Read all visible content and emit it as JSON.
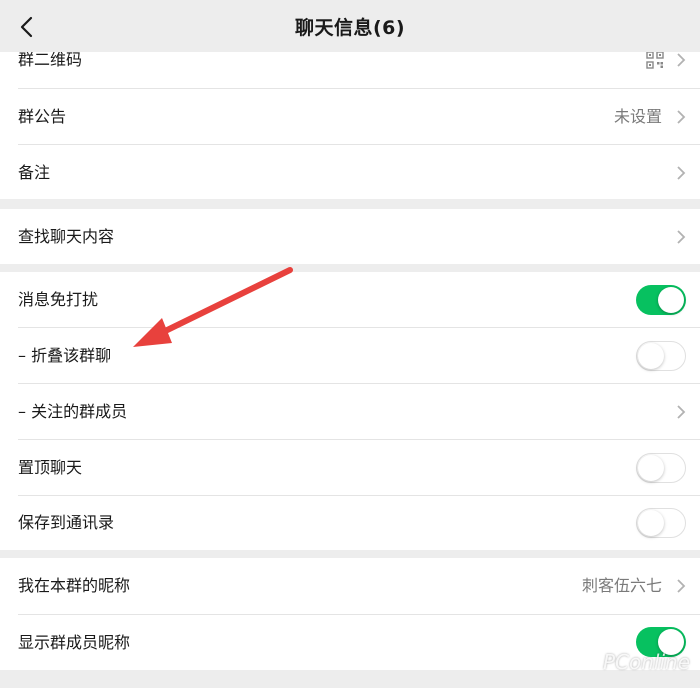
{
  "header": {
    "title": "聊天信息(6)"
  },
  "section1": {
    "rows": [
      {
        "label": "群二维码"
      },
      {
        "label": "群公告",
        "value": "未设置"
      },
      {
        "label": "备注"
      }
    ]
  },
  "section2": {
    "rows": [
      {
        "label": "查找聊天内容"
      }
    ]
  },
  "section3": {
    "rows": [
      {
        "label": "消息免打扰",
        "toggle": true
      },
      {
        "label": "– 折叠该群聊",
        "toggle": false
      },
      {
        "label": "– 关注的群成员"
      },
      {
        "label": "置顶聊天",
        "toggle": false
      },
      {
        "label": "保存到通讯录",
        "toggle": false
      }
    ]
  },
  "section4": {
    "rows": [
      {
        "label": "我在本群的昵称",
        "value": "刺客伍六七"
      },
      {
        "label": "显示群成员昵称",
        "toggle": true
      }
    ]
  },
  "watermark": "PConline",
  "colors": {
    "accent": "#07c160",
    "annotation_arrow": "#e8413d"
  }
}
